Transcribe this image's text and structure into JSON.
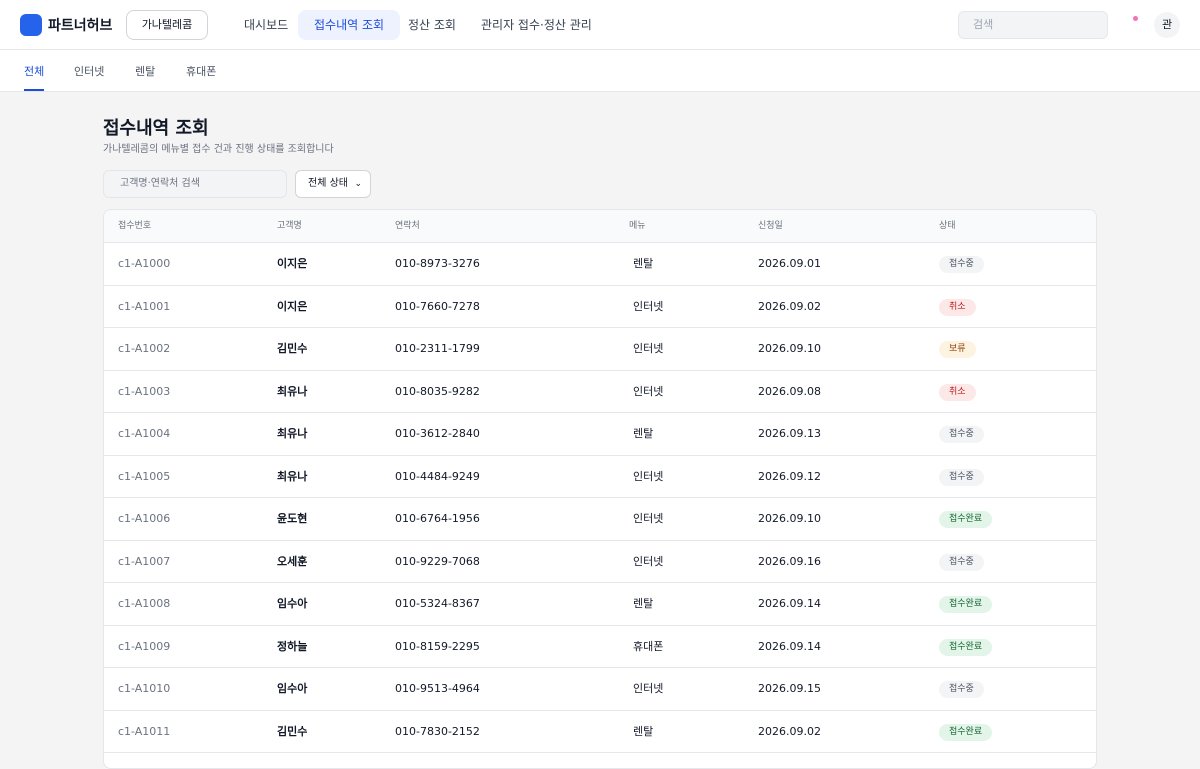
{
  "header": {
    "brand": "파트너허브",
    "company": "가나텔레콤",
    "nav": [
      "대시보드",
      "접수내역 조회",
      "정산 조회",
      "관리자 접수·정산 관리"
    ],
    "active_nav": 1,
    "search_placeholder": "검색",
    "avatar": "관"
  },
  "subtabs": [
    "전체",
    "인터넷",
    "렌탈",
    "휴대폰"
  ],
  "page": {
    "title": "접수내역 조회",
    "subtitle": "가나텔레콤의 메뉴별 접수 건과 진행 상태를 조회합니다"
  },
  "filters": {
    "search_placeholder": "고객명·연락처 검색",
    "status_select": "전체 상태"
  },
  "table": {
    "columns": [
      "접수번호",
      "고객명",
      "연락처",
      "메뉴",
      "신청일",
      "상태"
    ],
    "rows": [
      {
        "id": "c1-A1000",
        "name": "이지은",
        "phone": "010-8973-3276",
        "menu": "렌탈",
        "date": "2026.09.01",
        "status": "접수중"
      },
      {
        "id": "c1-A1001",
        "name": "이지은",
        "phone": "010-7660-7278",
        "menu": "인터넷",
        "date": "2026.09.02",
        "status": "취소"
      },
      {
        "id": "c1-A1002",
        "name": "김민수",
        "phone": "010-2311-1799",
        "menu": "인터넷",
        "date": "2026.09.10",
        "status": "보류"
      },
      {
        "id": "c1-A1003",
        "name": "최유나",
        "phone": "010-8035-9282",
        "menu": "인터넷",
        "date": "2026.09.08",
        "status": "취소"
      },
      {
        "id": "c1-A1004",
        "name": "최유나",
        "phone": "010-3612-2840",
        "menu": "렌탈",
        "date": "2026.09.13",
        "status": "접수중"
      },
      {
        "id": "c1-A1005",
        "name": "최유나",
        "phone": "010-4484-9249",
        "menu": "인터넷",
        "date": "2026.09.12",
        "status": "접수중"
      },
      {
        "id": "c1-A1006",
        "name": "윤도현",
        "phone": "010-6764-1956",
        "menu": "인터넷",
        "date": "2026.09.10",
        "status": "접수완료"
      },
      {
        "id": "c1-A1007",
        "name": "오세훈",
        "phone": "010-9229-7068",
        "menu": "인터넷",
        "date": "2026.09.16",
        "status": "접수중"
      },
      {
        "id": "c1-A1008",
        "name": "임수아",
        "phone": "010-5324-8367",
        "menu": "렌탈",
        "date": "2026.09.14",
        "status": "접수완료"
      },
      {
        "id": "c1-A1009",
        "name": "정하늘",
        "phone": "010-8159-2295",
        "menu": "휴대폰",
        "date": "2026.09.14",
        "status": "접수완료"
      },
      {
        "id": "c1-A1010",
        "name": "임수아",
        "phone": "010-9513-4964",
        "menu": "인터넷",
        "date": "2026.09.15",
        "status": "접수중"
      },
      {
        "id": "c1-A1011",
        "name": "김민수",
        "phone": "010-7830-2152",
        "menu": "렌탈",
        "date": "2026.09.02",
        "status": "접수완료"
      }
    ]
  },
  "status_colors": {
    "접수중": {
      "bg": "#f3f4f6",
      "fg": "#4b5563"
    },
    "취소": {
      "bg": "#fde8e8",
      "fg": "#b91c1c"
    },
    "보류": {
      "bg": "#fdf3e1",
      "fg": "#92400e"
    },
    "접수완료": {
      "bg": "#e3f5e9",
      "fg": "#166534"
    }
  },
  "accent": "#2563eb"
}
